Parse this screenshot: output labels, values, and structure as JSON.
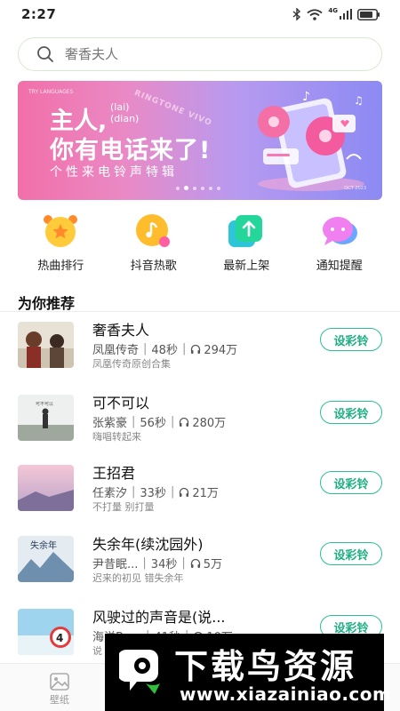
{
  "status_bar": {
    "time": "2:27",
    "network": "4G"
  },
  "search": {
    "placeholder": "奢香夫人"
  },
  "banner": {
    "small_text": "TRY LANGUAGES",
    "title_line1": "主人,",
    "pinyin_1": "(lai)",
    "pinyin_2": "(dian)",
    "title_line2": "你有电话来了!",
    "subtitle": "个性来电铃声特辑",
    "curved_text": "RINGTONE VIVO",
    "corner_text": "OCT 2023",
    "dot_count": 6,
    "active_dot": 1
  },
  "categories": [
    {
      "label": "热曲排行",
      "icon": "alarm-clock-star-icon"
    },
    {
      "label": "抖音热歌",
      "icon": "music-note-icon"
    },
    {
      "label": "最新上架",
      "icon": "upload-arrow-icon"
    },
    {
      "label": "通知提醒",
      "icon": "chat-bubble-icon"
    }
  ],
  "section_title": "为你推荐",
  "songs": [
    {
      "title": "奢香夫人",
      "artist": "凤凰传奇",
      "duration": "48秒",
      "plays": "294万",
      "album": "凤凰传奇原创合集",
      "button": "设彩铃"
    },
    {
      "title": "可不可以",
      "artist": "张紫豪",
      "duration": "56秒",
      "plays": "280万",
      "album": "嗨唱转起来",
      "button": "设彩铃"
    },
    {
      "title": "王招君",
      "artist": "任素汐",
      "duration": "33秒",
      "plays": "21万",
      "album": "不打量 别打量",
      "button": "设彩铃"
    },
    {
      "title": "失余年(续沈园外)",
      "artist": "尹昔眠...",
      "duration": "34秒",
      "plays": "5万",
      "album": "迟来的初见 错失余年",
      "button": "设彩铃"
    },
    {
      "title": "风驶过的声音是(说...",
      "artist": "海洋Bo...",
      "duration": "41秒",
      "plays": "10万",
      "album": "说",
      "button": "设彩铃"
    }
  ],
  "tabbar": {
    "wallpaper_label": "壁纸"
  },
  "watermark": {
    "text": "下载鸟资源",
    "url": "www.xiazainiao.com"
  }
}
